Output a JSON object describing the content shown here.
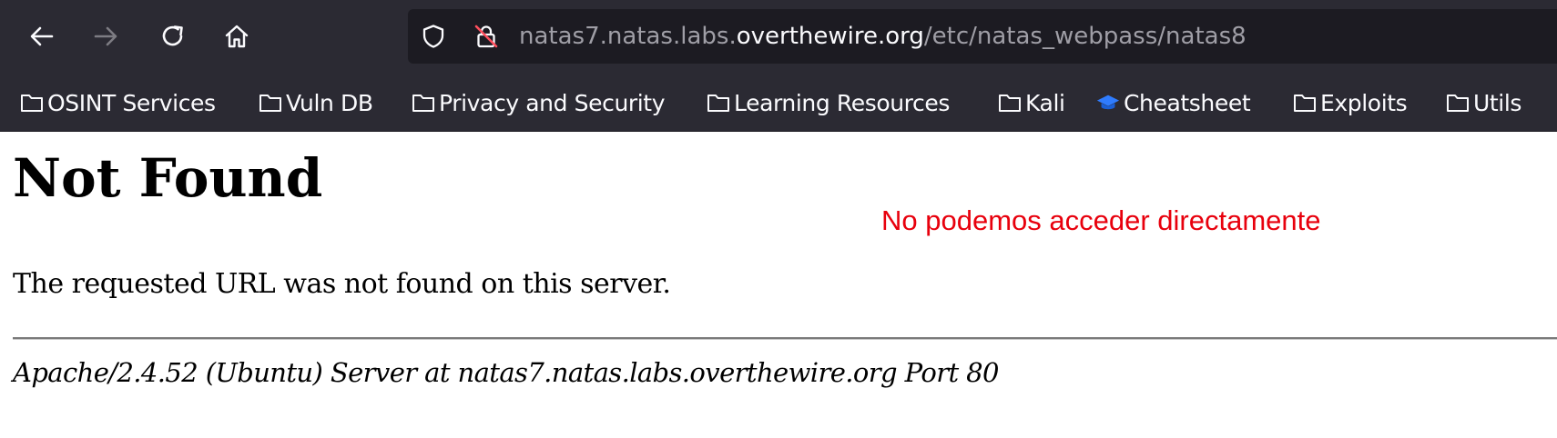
{
  "colors": {
    "toolbar_bg": "#2b2a33",
    "urlbar_bg": "#1c1b22",
    "annotation": "#e8000d",
    "bookmark_icon_special": "#2f7cff"
  },
  "toolbar": {
    "back_icon": "arrow-left-icon",
    "forward_icon": "arrow-right-icon",
    "reload_icon": "reload-icon",
    "home_icon": "home-icon"
  },
  "urlbar": {
    "shield_icon": "shield-icon",
    "insecure_icon": "insecure-lock-icon",
    "url_prefix": "natas7.natas.labs.",
    "url_domain": "overthewire.org",
    "url_path": "/etc/natas_webpass/natas8"
  },
  "bookmarks": [
    {
      "label": "OSINT Services",
      "icon": "folder-icon"
    },
    {
      "label": "Vuln DB",
      "icon": "folder-icon"
    },
    {
      "label": "Privacy and Security",
      "icon": "folder-icon"
    },
    {
      "label": "Learning Resources",
      "icon": "folder-icon"
    },
    {
      "label": "Kali",
      "icon": "folder-icon"
    },
    {
      "label": "Cheatsheet",
      "icon": "graduation-cap-icon"
    },
    {
      "label": "Exploits",
      "icon": "folder-icon"
    },
    {
      "label": "Utils",
      "icon": "folder-icon"
    }
  ],
  "page": {
    "title": "Not Found",
    "message": "The requested URL was not found on this server.",
    "address": "Apache/2.4.52 (Ubuntu) Server at natas7.natas.labs.overthewire.org Port 80"
  },
  "annotation": {
    "text": "No podemos acceder directamente"
  }
}
